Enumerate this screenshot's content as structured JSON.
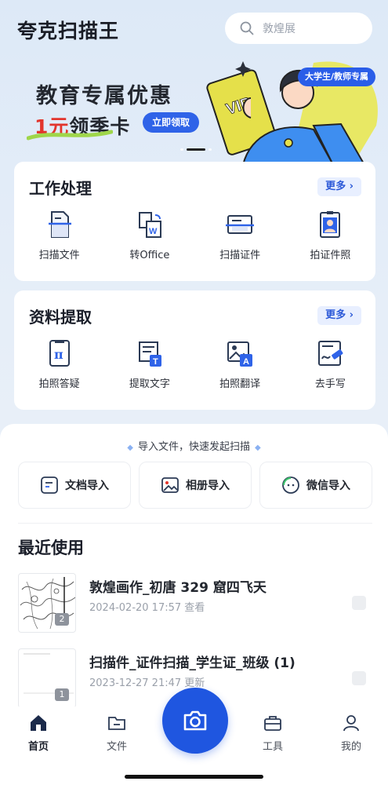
{
  "header": {
    "app_title": "夸克扫描王",
    "search_placeholder": "敦煌展"
  },
  "banner": {
    "headline": "教育专属优惠",
    "price": "1元",
    "price_suffix": "领季卡",
    "claim_label": "立即领取",
    "badge": "大学生/教师专属",
    "card_text": "VIP"
  },
  "work_card": {
    "title": "工作处理",
    "more_label": "更多 ›",
    "items": [
      {
        "label": "扫描文件",
        "icon": "scan-file-icon"
      },
      {
        "label": "转Office",
        "icon": "word-convert-icon"
      },
      {
        "label": "扫描证件",
        "icon": "id-card-icon"
      },
      {
        "label": "拍证件照",
        "icon": "id-photo-icon"
      }
    ]
  },
  "extract_card": {
    "title": "资料提取",
    "more_label": "更多 ›",
    "items": [
      {
        "label": "拍照答疑",
        "icon": "pi-answer-icon"
      },
      {
        "label": "提取文字",
        "icon": "extract-text-icon"
      },
      {
        "label": "拍照翻译",
        "icon": "photo-translate-icon"
      },
      {
        "label": "去手写",
        "icon": "remove-handwriting-icon"
      }
    ]
  },
  "import": {
    "hint": "导入文件，快速发起扫描",
    "buttons": [
      {
        "label": "文档导入",
        "icon": "document-import-icon"
      },
      {
        "label": "相册导入",
        "icon": "album-import-icon"
      },
      {
        "label": "微信导入",
        "icon": "wechat-import-icon"
      }
    ]
  },
  "recent": {
    "title": "最近使用",
    "files": [
      {
        "name": "敦煌画作_初唐 329 窟四飞天",
        "meta": "2024-02-20 17:57 查看",
        "count": "2"
      },
      {
        "name": "扫描件_证件扫描_学生证_班级 (1)",
        "meta": "2023-12-27 21:47 更新",
        "count": "1"
      }
    ]
  },
  "tabbar": {
    "tabs": [
      {
        "label": "首页",
        "icon": "home-icon"
      },
      {
        "label": "文件",
        "icon": "folder-icon"
      },
      {
        "label": "工具",
        "icon": "toolbox-icon"
      },
      {
        "label": "我的",
        "icon": "profile-icon"
      }
    ],
    "fab_icon": "camera-icon"
  },
  "colors": {
    "accent": "#1f56e0",
    "highlight_red": "#e2352d",
    "banner_yellow": "#e9e84a"
  }
}
